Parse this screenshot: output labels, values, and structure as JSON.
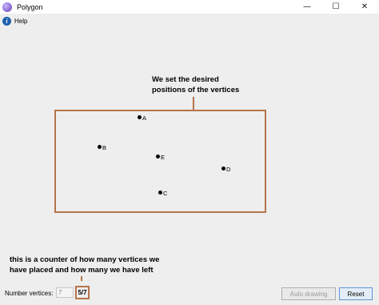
{
  "window": {
    "title": "Polygon",
    "controls": {
      "minimize": "—",
      "maximize": "☐",
      "close": "✕"
    }
  },
  "menu": {
    "help": "Help",
    "help_icon": "i"
  },
  "annotations": {
    "vertices_note_line1": "We set the desired",
    "vertices_note_line2": "positions of the vertices",
    "counter_note_line1": "this is a counter of how many vertices we",
    "counter_note_line2": "have placed and how many we have left",
    "accent_color": "#b5754a"
  },
  "vertices": [
    {
      "label": "A"
    },
    {
      "label": "B"
    },
    {
      "label": "E"
    },
    {
      "label": "D"
    },
    {
      "label": "C"
    }
  ],
  "controls": {
    "number_vertices_label": "Number vertices:",
    "number_vertices_value": "7",
    "counter": "5/7",
    "auto_drawing": "Auto drawing",
    "reset": "Reset"
  }
}
